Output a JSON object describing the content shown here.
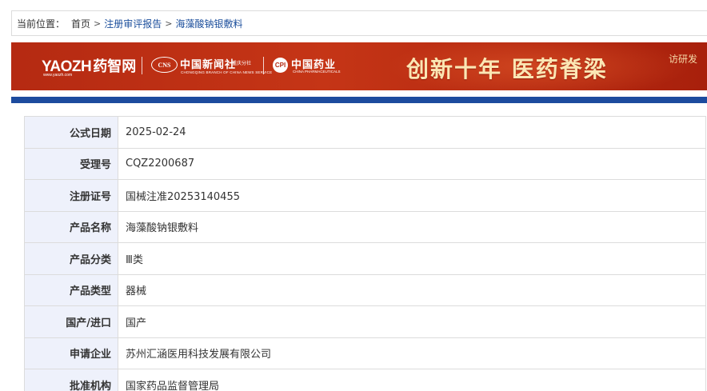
{
  "breadcrumb": {
    "label": "当前位置：",
    "items": [
      "首页",
      "注册审评报告",
      "海藻酸钠银敷料"
    ],
    "separator": ">"
  },
  "banner": {
    "yaozh_logo_en": "YAOZH",
    "yaozh_logo_cn": "药智网",
    "yaozh_url": "www.yaozh.com",
    "cns_badge": "CNS",
    "cns_name": "中国新闻社",
    "cns_branch": "重庆分社",
    "cns_sub": "CHONGQING BRANCH OF CHINA NEWS SERVICE",
    "cpi_badge": "CPI",
    "cpi_name": "中国药业",
    "cpi_sub": "CHINA PHARMACEUTICALS",
    "slogan": "创新十年 医药脊梁",
    "right_text": "访研发"
  },
  "details": {
    "rows": [
      {
        "label": "公式日期",
        "value": "2025-02-24"
      },
      {
        "label": "受理号",
        "value": "CQZ2200687"
      },
      {
        "label": "注册证号",
        "value": "国械注准20253140455"
      },
      {
        "label": "产品名称",
        "value": "海藻酸钠银敷料"
      },
      {
        "label": "产品分类",
        "value": "Ⅲ类"
      },
      {
        "label": "产品类型",
        "value": "器械"
      },
      {
        "label": "国产/进口",
        "value": "国产"
      },
      {
        "label": "申请企业",
        "value": "苏州汇涵医用科技发展有限公司"
      },
      {
        "label": "批准机构",
        "value": "国家药品监督管理局"
      }
    ]
  },
  "colors": {
    "banner_red": "#b52a12",
    "blue_bar": "#1d4b9e",
    "link_blue": "#1c4f9c",
    "label_bg": "#eef1fb"
  }
}
